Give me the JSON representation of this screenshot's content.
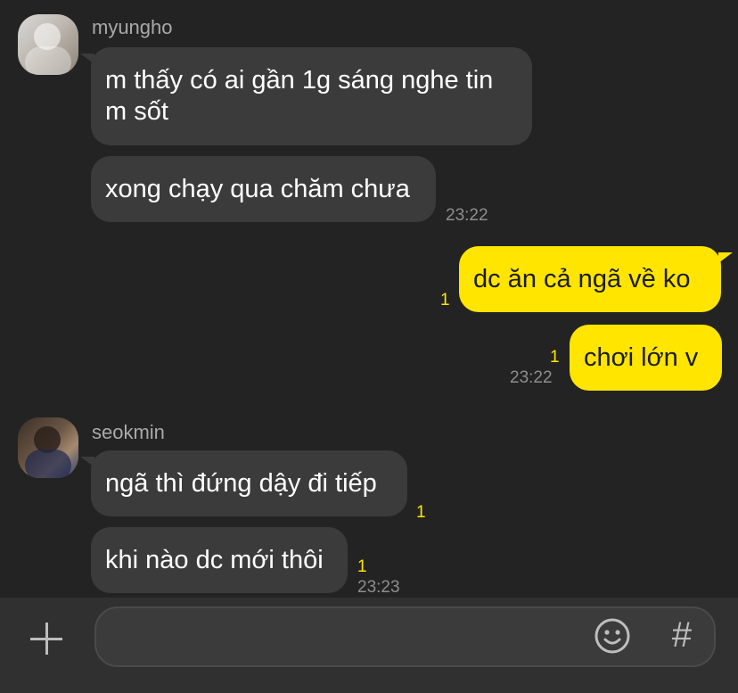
{
  "messages": [
    {
      "sender": "myungho",
      "bubbles": [
        "m thấy có ai gần 1g sáng nghe tin m sốt",
        "xong chạy qua chăm chưa"
      ],
      "time": "23:22"
    },
    {
      "sender": "me",
      "bubbles": [
        "dc ăn cả ngã về ko",
        "chơi lớn v"
      ],
      "unread": [
        "1",
        "1"
      ],
      "time": "23:22"
    },
    {
      "sender": "seokmin",
      "bubbles": [
        "ngã thì đứng dậy đi tiếp",
        "khi nào dc mới thôi"
      ],
      "unread": [
        "1",
        "1"
      ],
      "time": "23:23"
    }
  ],
  "composer": {
    "input_value": "",
    "plus_icon": "plus-icon",
    "emoji_icon": "smiley-icon",
    "hash_glyph": "#"
  },
  "colors": {
    "background": "#232323",
    "incoming_bubble": "#3b3b3b",
    "outgoing_bubble": "#ffe500",
    "unread_count": "#ffe500",
    "timestamp": "#8e8e8e"
  }
}
